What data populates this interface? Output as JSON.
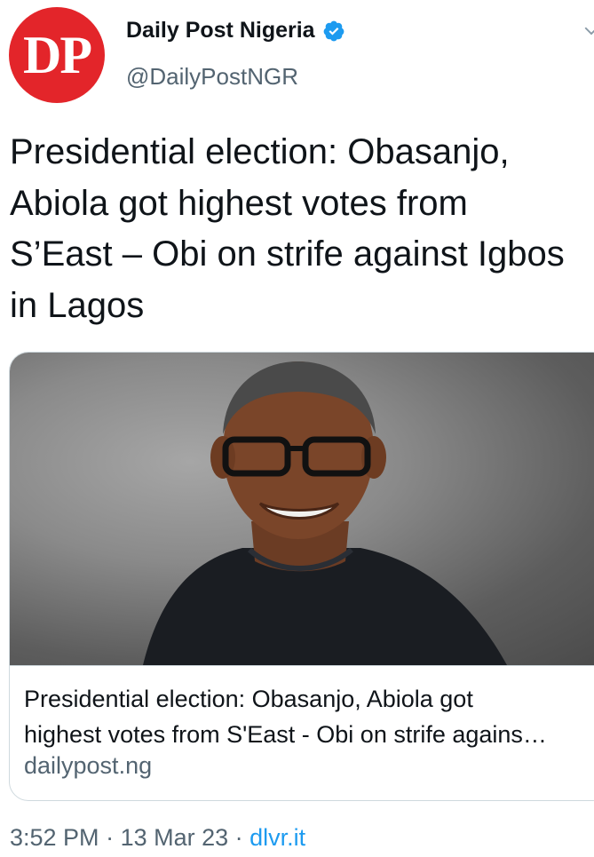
{
  "author": {
    "avatar_text": "DP",
    "name": "Daily Post Nigeria",
    "handle": "@DailyPostNGR"
  },
  "tweet": {
    "text": "Presidential election: Obasanjo,\nAbiola got highest votes from\nS’East – Obi on strife against Igbos\nin Lagos"
  },
  "card": {
    "title_line1": "Presidential election: Obasanjo, Abiola got",
    "title_line2": "highest votes from S'East - Obi on strife agains…",
    "domain": "dailypost.ng"
  },
  "meta": {
    "time": "3:52 PM",
    "sep1": " · ",
    "date": "13 Mar 23",
    "sep2": " · ",
    "source": "dlvr.it"
  },
  "colors": {
    "avatar_bg": "#e3252a",
    "verified": "#1d9bf0",
    "link": "#1d9bf0",
    "muted": "#536471"
  },
  "icons": [
    "verified-badge-icon",
    "chevron-down-icon"
  ]
}
